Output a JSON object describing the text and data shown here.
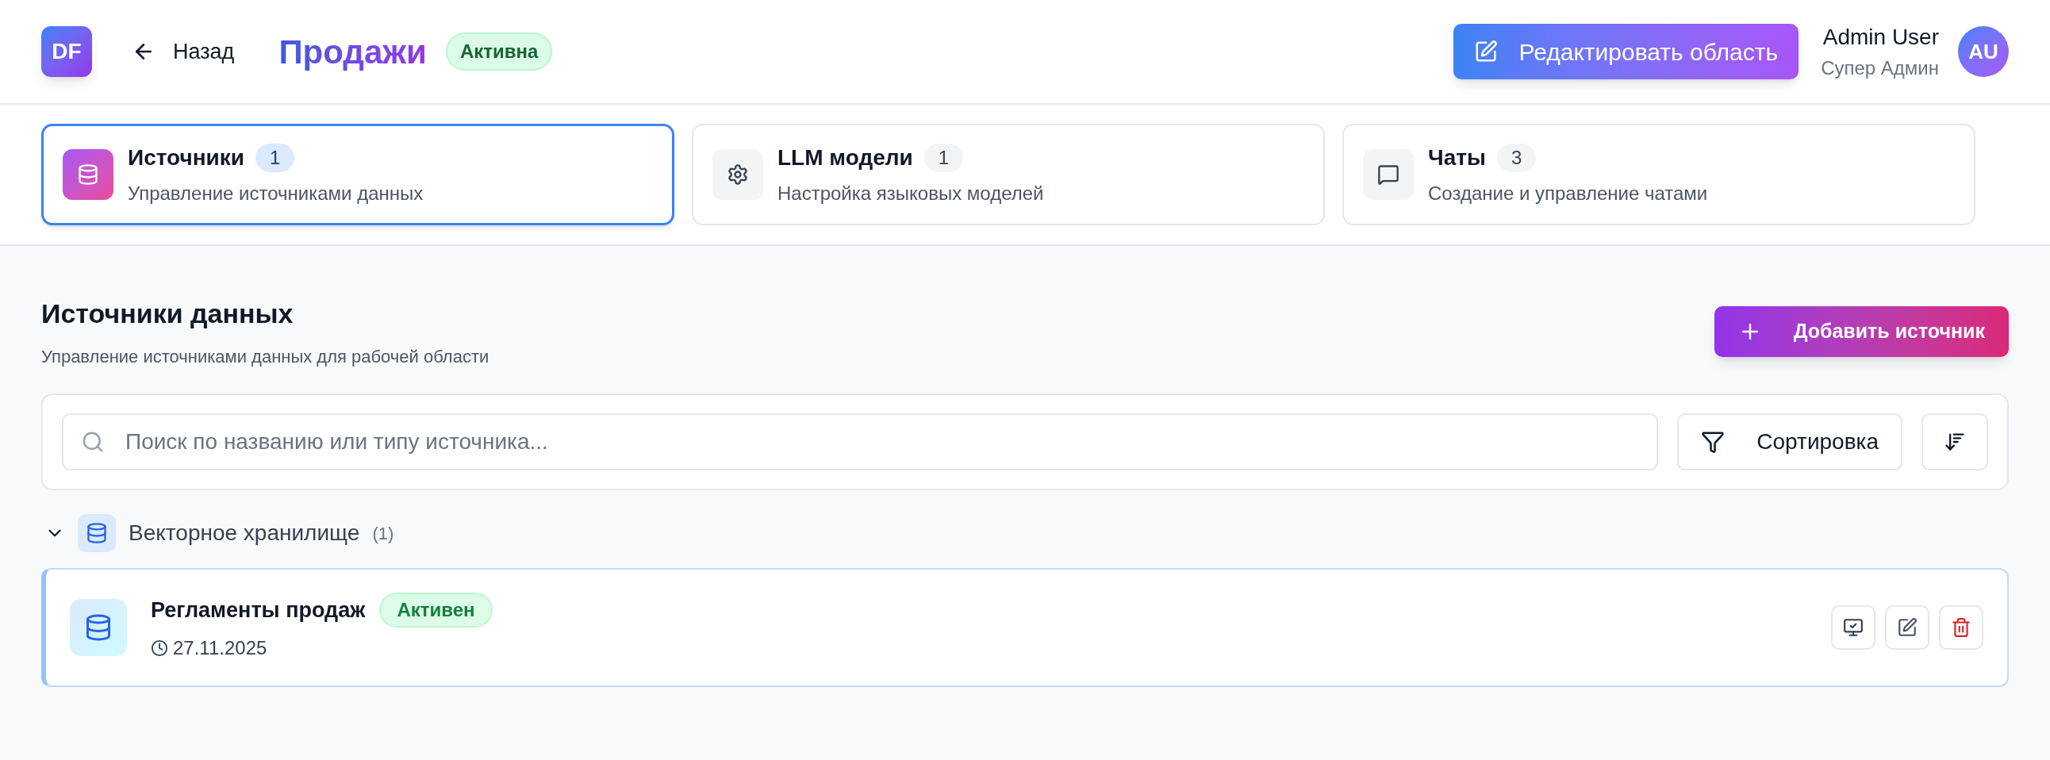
{
  "header": {
    "logo": "DF",
    "back": "Назад",
    "title": "Продажи",
    "status": "Активна",
    "edit_button": "Редактировать область",
    "user": {
      "name": "Admin User",
      "role": "Супер Админ",
      "initials": "AU"
    }
  },
  "tabs": [
    {
      "kind": "sources",
      "title": "Источники",
      "count": "1",
      "subtitle": "Управление источниками данных",
      "selected": true
    },
    {
      "kind": "llm",
      "title": "LLM модели",
      "count": "1",
      "subtitle": "Настройка языковых моделей",
      "selected": false
    },
    {
      "kind": "chats",
      "title": "Чаты",
      "count": "3",
      "subtitle": "Создание и управление чатами",
      "selected": false
    }
  ],
  "section": {
    "title": "Источники данных",
    "subtitle": "Управление источниками данных для рабочей области",
    "add_button": "Добавить источник"
  },
  "search": {
    "placeholder": "Поиск по названию или типу источника...",
    "sort_button": "Сортировка"
  },
  "groups": [
    {
      "name": "Векторное хранилище",
      "count": "(1)",
      "expanded": true,
      "items": [
        {
          "name": "Регламенты продаж",
          "status": "Активен",
          "date": "27.11.2025"
        }
      ]
    }
  ]
}
